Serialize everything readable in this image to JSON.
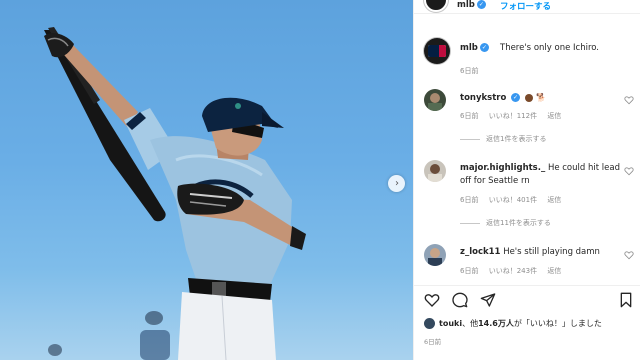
{
  "header": {
    "username": "mlb",
    "follow_label": "フォローする"
  },
  "caption": {
    "username": "mlb",
    "text": "There's only one Ichiro.",
    "time": "6日前"
  },
  "comments": [
    {
      "username": "tonykstro",
      "text": "",
      "emojis": "",
      "time": "6日前",
      "likes": "いいね！112件",
      "reply": "返信",
      "view_replies": "返信1件を表示する"
    },
    {
      "username": "major.highlights._",
      "text": "He could hit lead off for Seattle rn",
      "time": "6日前",
      "likes": "いいね！401件",
      "reply": "返信",
      "view_replies": "返信11件を表示する"
    },
    {
      "username": "z_lock11",
      "text": "He's still playing damn",
      "time": "6日前",
      "likes": "いいね！243件",
      "reply": "返信"
    }
  ],
  "likes_summary": {
    "first_user": "touki",
    "middle": "、他",
    "count": "14.6万人",
    "suffix": "が「いいね！」しました"
  },
  "post_time": "6日前",
  "colors": {
    "accent": "#0095f6",
    "verified": "#3897f0",
    "jersey": "#9cc3e0",
    "navy": "#0c2340"
  },
  "icons": {
    "next": "chevron-right-icon",
    "like": "heart-icon",
    "comment": "comment-icon",
    "share": "paper-plane-icon",
    "save": "bookmark-icon"
  }
}
